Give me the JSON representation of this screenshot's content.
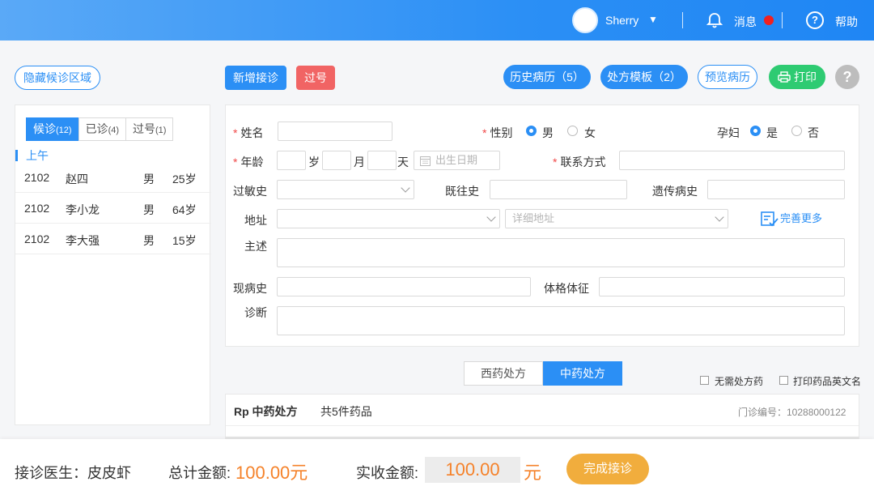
{
  "header": {
    "user": "Sherry",
    "messages_label": "消息",
    "help_label": "帮助"
  },
  "toolbar": {
    "hide_waiting": "隐藏候诊区域",
    "new_visit": "新增接诊",
    "skip": "过号",
    "history": "历史病历（5）",
    "template": "处方模板（2）",
    "preview": "预览病历",
    "print": "打印"
  },
  "queue": {
    "tabs": [
      {
        "label": "候诊",
        "count": "(12)"
      },
      {
        "label": "已诊",
        "count": "(4)"
      },
      {
        "label": "过号",
        "count": "(1)"
      }
    ],
    "period": "上午",
    "patients": [
      {
        "id": "2102",
        "name": "赵四",
        "sex": "男",
        "age": "25岁"
      },
      {
        "id": "2102",
        "name": "李小龙",
        "sex": "男",
        "age": "64岁"
      },
      {
        "id": "2102",
        "name": "李大强",
        "sex": "男",
        "age": "15岁"
      }
    ]
  },
  "form": {
    "name": "姓名",
    "gender": "性别",
    "male": "男",
    "female": "女",
    "pregnant": "孕妇",
    "yes": "是",
    "no": "否",
    "age": "年龄",
    "unit_year": "岁",
    "unit_month": "月",
    "unit_day": "天",
    "birth_placeholder": "出生日期",
    "contact": "联系方式",
    "allergy": "过敏史",
    "past": "既往史",
    "genetic": "遗传病史",
    "address": "地址",
    "address_detail_placeholder": "详细地址",
    "complete_more": "完善更多",
    "chief": "主述",
    "present": "现病史",
    "physical": "体格体征",
    "diagnosis": "诊断"
  },
  "prescription": {
    "tabs": [
      "西药处方",
      "中药处方"
    ],
    "no_rx": "无需处方药",
    "print_en": "打印药品英文名",
    "title": "Rp 中药处方",
    "count": "共5件药品",
    "clinic_no": "门诊编号：10288000122"
  },
  "footer": {
    "doctor": "接诊医生：皮皮虾",
    "total_label": "总计金额:",
    "total": "100.00元",
    "received_label": "实收金额:",
    "received": "100.00",
    "unit": "元",
    "finish": "完成接诊"
  },
  "colors": {
    "primary": "#2b8ff5",
    "danger": "#f16464",
    "green": "#2ecb72",
    "orange": "#f5822a",
    "finish": "#f1ad3d"
  }
}
